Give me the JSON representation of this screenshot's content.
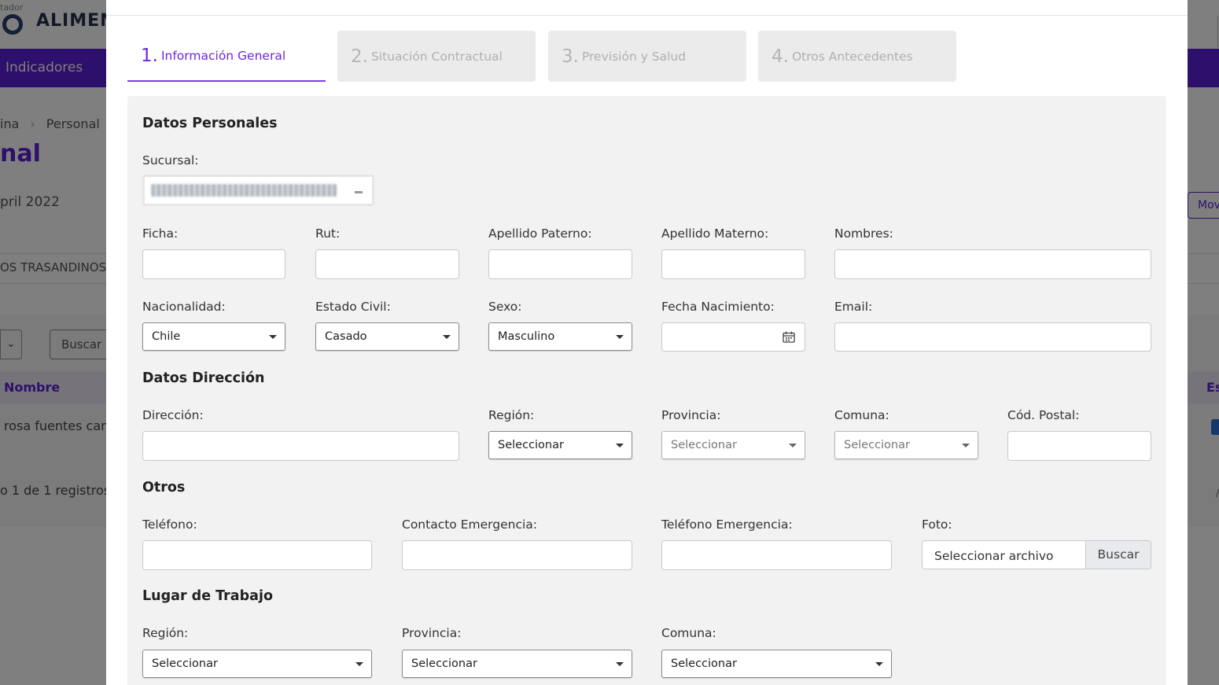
{
  "background": {
    "logo_sub": "tador",
    "logo_text": "ALIMENT",
    "nav_item": "Indicadores",
    "breadcrumb_first": "ina",
    "breadcrumb_second": "Personal",
    "page_title": "nal",
    "date": "pril 2022",
    "company": "OS TRASANDINOS S",
    "select_stub": "⌄",
    "search_button": "Buscar",
    "col_name": "Nombre",
    "col_es": "Es",
    "cell_name": "rosa fuentes canc",
    "records": "o 1 de 1 registros",
    "mov_button": "Mov",
    "right_mark": "/"
  },
  "steps": [
    {
      "num": "1.",
      "label": "Información General"
    },
    {
      "num": "2.",
      "label": "Situación Contractual"
    },
    {
      "num": "3.",
      "label": "Previsión y Salud"
    },
    {
      "num": "4.",
      "label": "Otros Antecedentes"
    }
  ],
  "personal": {
    "title": "Datos Personales",
    "sucursal_label": "Sucursal:",
    "ficha_label": "Ficha:",
    "rut_label": "Rut:",
    "ap_paterno_label": "Apellido Paterno:",
    "ap_materno_label": "Apellido Materno:",
    "nombres_label": "Nombres:",
    "nacionalidad_label": "Nacionalidad:",
    "nacionalidad_value": "Chile",
    "estado_civil_label": "Estado Civil:",
    "estado_civil_value": "Casado",
    "sexo_label": "Sexo:",
    "sexo_value": "Masculino",
    "fecha_nac_label": "Fecha Nacimiento:",
    "email_label": "Email:"
  },
  "direccion": {
    "title": "Datos Dirección",
    "direccion_label": "Dirección:",
    "region_label": "Región:",
    "region_value": "Seleccionar",
    "provincia_label": "Provincia:",
    "provincia_value": "Seleccionar",
    "comuna_label": "Comuna:",
    "comuna_value": "Seleccionar",
    "cod_postal_label": "Cód. Postal:"
  },
  "otros": {
    "title": "Otros",
    "telefono_label": "Teléfono:",
    "contacto_label": "Contacto Emergencia:",
    "tel_emergencia_label": "Teléfono Emergencia:",
    "foto_label": "Foto:",
    "file_placeholder": "Seleccionar archivo",
    "file_button": "Buscar"
  },
  "trabajo": {
    "title": "Lugar de Trabajo",
    "region_label": "Región:",
    "region_value": "Seleccionar",
    "provincia_label": "Provincia:",
    "provincia_value": "Seleccionar",
    "comuna_label": "Comuna:",
    "comuna_value": "Seleccionar"
  },
  "icons": {
    "calendar": "calendar-icon",
    "caret": "chevron-down-icon"
  }
}
